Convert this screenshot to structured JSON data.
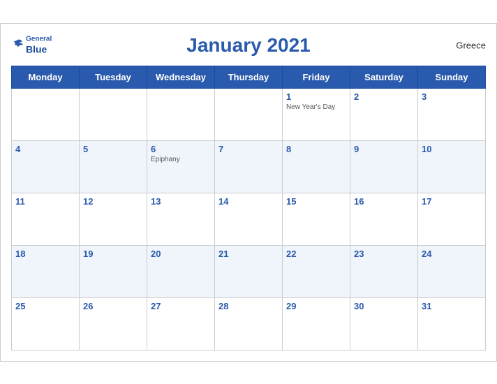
{
  "header": {
    "title": "January 2021",
    "country": "Greece",
    "logo_general": "General",
    "logo_blue": "Blue"
  },
  "days_of_week": [
    "Monday",
    "Tuesday",
    "Wednesday",
    "Thursday",
    "Friday",
    "Saturday",
    "Sunday"
  ],
  "weeks": [
    [
      {
        "date": "",
        "event": ""
      },
      {
        "date": "",
        "event": ""
      },
      {
        "date": "",
        "event": ""
      },
      {
        "date": "",
        "event": ""
      },
      {
        "date": "1",
        "event": "New Year's Day"
      },
      {
        "date": "2",
        "event": ""
      },
      {
        "date": "3",
        "event": ""
      }
    ],
    [
      {
        "date": "4",
        "event": ""
      },
      {
        "date": "5",
        "event": ""
      },
      {
        "date": "6",
        "event": "Epiphany"
      },
      {
        "date": "7",
        "event": ""
      },
      {
        "date": "8",
        "event": ""
      },
      {
        "date": "9",
        "event": ""
      },
      {
        "date": "10",
        "event": ""
      }
    ],
    [
      {
        "date": "11",
        "event": ""
      },
      {
        "date": "12",
        "event": ""
      },
      {
        "date": "13",
        "event": ""
      },
      {
        "date": "14",
        "event": ""
      },
      {
        "date": "15",
        "event": ""
      },
      {
        "date": "16",
        "event": ""
      },
      {
        "date": "17",
        "event": ""
      }
    ],
    [
      {
        "date": "18",
        "event": ""
      },
      {
        "date": "19",
        "event": ""
      },
      {
        "date": "20",
        "event": ""
      },
      {
        "date": "21",
        "event": ""
      },
      {
        "date": "22",
        "event": ""
      },
      {
        "date": "23",
        "event": ""
      },
      {
        "date": "24",
        "event": ""
      }
    ],
    [
      {
        "date": "25",
        "event": ""
      },
      {
        "date": "26",
        "event": ""
      },
      {
        "date": "27",
        "event": ""
      },
      {
        "date": "28",
        "event": ""
      },
      {
        "date": "29",
        "event": ""
      },
      {
        "date": "30",
        "event": ""
      },
      {
        "date": "31",
        "event": ""
      }
    ]
  ]
}
